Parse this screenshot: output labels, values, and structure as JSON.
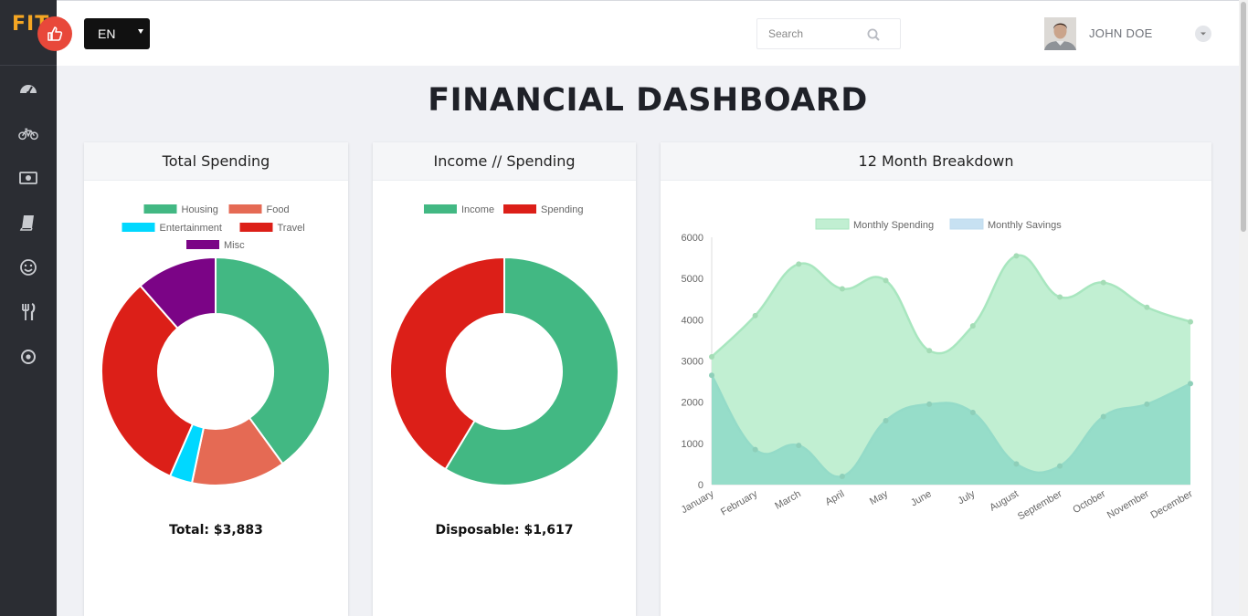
{
  "brand": {
    "text": "FIT"
  },
  "topbar": {
    "language": "EN",
    "search_placeholder": "Search",
    "user_name": "JOHN DOE"
  },
  "sidebar": {
    "icons": [
      "dashboard-icon",
      "bicycle-icon",
      "money-icon",
      "book-icon",
      "smile-icon",
      "utensils-icon",
      "target-icon"
    ]
  },
  "page": {
    "title": "FINANCIAL DASHBOARD"
  },
  "cards": {
    "total_spending": {
      "title": "Total Spending",
      "total_label": "Total: $3,883"
    },
    "income_spending": {
      "title": "Income // Spending",
      "disposable_label": "Disposable: $1,617"
    },
    "breakdown": {
      "title": "12 Month Breakdown"
    }
  },
  "colors": {
    "housing": "#42b883",
    "food": "#e56a54",
    "entertainment": "#00d8ff",
    "travel": "#dc1f18",
    "misc": "#7b0486",
    "income": "#42b883",
    "spending": "#dc1f18",
    "monthly_spending_fill": "#c1efd2",
    "monthly_spending_line": "#a8e6bf",
    "monthly_savings_fill": "#94dbc8",
    "monthly_savings_line": "#c2dcef"
  },
  "chart_data": [
    {
      "type": "pie",
      "variant": "doughnut",
      "labels": [
        "Housing",
        "Food",
        "Entertainment",
        "Travel",
        "Misc"
      ],
      "values": [
        1500,
        500,
        120,
        1200,
        430
      ],
      "colors": [
        "#42b883",
        "#e56a54",
        "#00d8ff",
        "#dc1f18",
        "#7b0486"
      ],
      "legend": "top"
    },
    {
      "type": "pie",
      "variant": "doughnut",
      "labels": [
        "Income",
        "Spending"
      ],
      "values": [
        5500,
        3883
      ],
      "colors": [
        "#42b883",
        "#dc1f18"
      ],
      "legend": "top"
    },
    {
      "type": "area",
      "categories": [
        "January",
        "February",
        "March",
        "April",
        "May",
        "June",
        "July",
        "August",
        "September",
        "October",
        "November",
        "December"
      ],
      "series": [
        {
          "name": "Monthly Spending",
          "values": [
            3100,
            4100,
            5350,
            4750,
            4950,
            3250,
            3850,
            5550,
            4550,
            4900,
            4300,
            3950
          ]
        },
        {
          "name": "Monthly Savings",
          "values": [
            2650,
            850,
            950,
            200,
            1550,
            1950,
            1750,
            500,
            450,
            1650,
            1950,
            2450
          ]
        }
      ],
      "ylim": [
        0,
        6000
      ],
      "yticks": [
        0,
        1000,
        2000,
        3000,
        4000,
        5000,
        6000
      ],
      "legend": "top",
      "grid": false
    }
  ]
}
